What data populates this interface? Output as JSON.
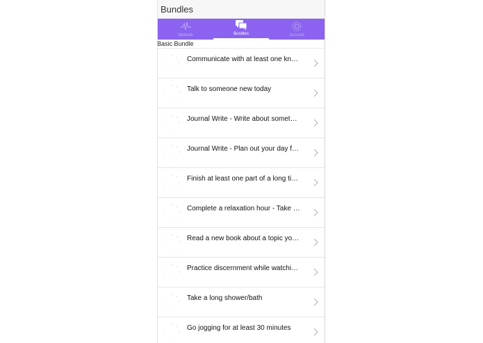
{
  "header": {
    "title": "Bundles"
  },
  "tabs": [
    {
      "label": "Website",
      "icon": "pulse-icon",
      "active": false
    },
    {
      "label": "Bundles",
      "icon": "chat-bubbles-icon",
      "active": true
    },
    {
      "label": "Account",
      "icon": "gear-icon",
      "active": false
    }
  ],
  "section": {
    "label": "Basic Bundle"
  },
  "tasks": [
    {
      "text": "Communicate with at least one know someone"
    },
    {
      "text": "Talk to someone new today"
    },
    {
      "text": "Journal Write - Write about something today"
    },
    {
      "text": "Journal Write - Plan out your day for tomorrow"
    },
    {
      "text": "Finish at least one part of a long time project"
    },
    {
      "text": "Complete a relaxation hour - Take time off"
    },
    {
      "text": "Read a new book about a topic you like"
    },
    {
      "text": "Practice discernment while watching TV"
    },
    {
      "text": "Take a long shower/bath"
    },
    {
      "text": "Go jogging for at least 30 minutes"
    }
  ],
  "colors": {
    "accent": "#8b63f0",
    "header_bg": "#f7f7f7",
    "divider": "#e5e5e5"
  }
}
